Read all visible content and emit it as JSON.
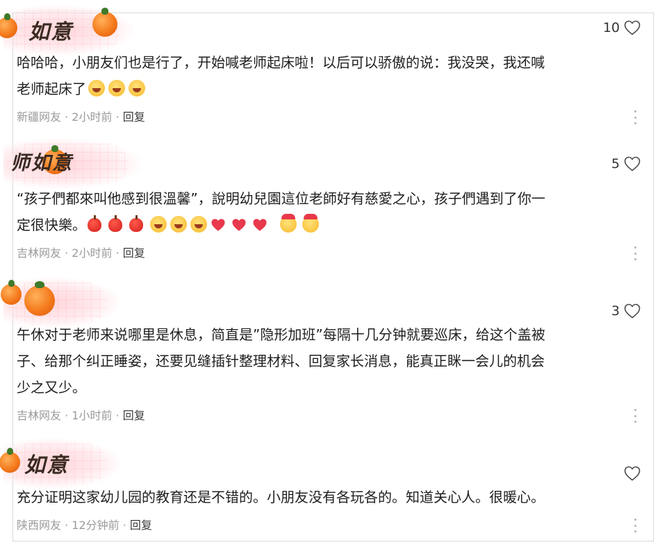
{
  "comments": [
    {
      "sticker_text": "如意",
      "likes": "10",
      "text_line1": "哈哈哈，小朋友们也是行了，开始喊老师起床啦！以后可以骄傲的说：我没哭，我还喊",
      "text_line2": "老师起床了",
      "location": "新疆网友",
      "time": "2小时前",
      "reply": "回复",
      "emojis": [
        "laugh",
        "laugh",
        "laugh"
      ]
    },
    {
      "sticker_text": "师如意",
      "likes": "5",
      "text_line1": "“孩子們都來叫他感到很溫馨”，說明幼兒園這位老師好有慈愛之心，孩子們遇到了你一",
      "text_line2": "定很快樂。",
      "location": "吉林网友",
      "time": "2小时前",
      "reply": "回复",
      "emojis": [
        "apple",
        "apple",
        "apple",
        "laugh",
        "laugh",
        "laugh",
        "heart",
        "heart",
        "heart",
        "kiss",
        "kiss"
      ]
    },
    {
      "sticker_text": "",
      "likes": "3",
      "text_line1": "午休对于老师来说哪里是休息，简直是”隐形加班”每隔十几分钟就要巡床，给这个盖被",
      "text_line2": "子、给那个纠正睡姿，还要见缝插针整理材料、回复家长消息，能真正眯一会儿的机会",
      "text_line3": "少之又少。",
      "location": "吉林网友",
      "time": "1小时前",
      "reply": "回复"
    },
    {
      "sticker_text": "如意",
      "likes": "",
      "text_line1": "充分证明这家幼儿园的教育还是不错的。小朋友没有各玩各的。知道关心人。很暖心。",
      "location": "陕西网友",
      "time": "12分钟前",
      "reply": "回复"
    }
  ],
  "separator": " · ",
  "icons": {
    "like": "heart-outline-icon",
    "more": "more-vertical-icon"
  },
  "colors": {
    "meta": "#9a9a9a",
    "text": "#1f1f1f",
    "sticker_pink": "#ffcdd2",
    "persimmon": "#f47a1c"
  }
}
